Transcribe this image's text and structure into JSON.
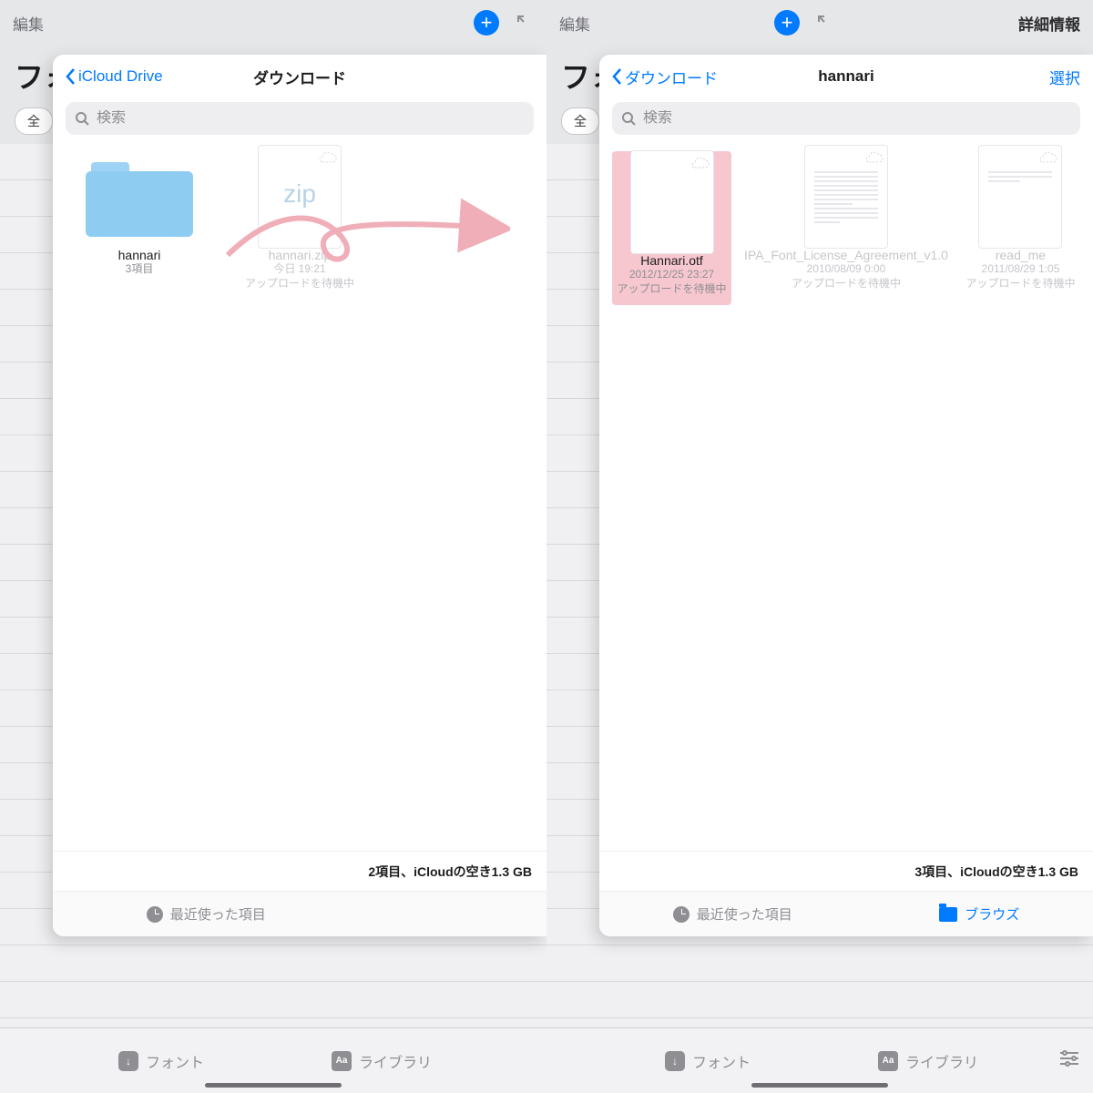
{
  "bg": {
    "edit": "編集",
    "heading_prefix": "フォ",
    "chip": "全",
    "details": "詳細情報",
    "bottom": {
      "fonts": "フォント",
      "library": "ライブラリ"
    }
  },
  "search": {
    "placeholder": "検索"
  },
  "left": {
    "back": "iCloud Drive",
    "title": "ダウンロード",
    "items": [
      {
        "type": "folder",
        "name": "hannari",
        "sub": "3項目"
      },
      {
        "type": "zip",
        "name": "hannari.zip",
        "sub1": "今日 19:21",
        "sub2": "アップロードを待機中"
      }
    ],
    "status": "2項目、iCloudの空き1.3 GB"
  },
  "right": {
    "back": "ダウンロード",
    "title": "hannari",
    "select": "選択",
    "items": [
      {
        "type": "file",
        "name": "Hannari.otf",
        "sub1": "2012/12/25 23:27",
        "sub2": "アップロードを待機中",
        "highlight": true
      },
      {
        "type": "file",
        "name": "IPA_Font_License_Agreement_v1.0",
        "sub1": "2010/08/09 0:00",
        "sub2": "アップロードを待機中",
        "faded": true,
        "lines": true
      },
      {
        "type": "file",
        "name": "read_me",
        "sub1": "2011/08/29 1:05",
        "sub2": "アップロードを待機中",
        "faded": true,
        "lines": true
      }
    ],
    "status": "3項目、iCloudの空き1.3 GB"
  },
  "tabs": {
    "recent": "最近使った項目",
    "browse": "ブラウズ"
  },
  "annotation": {
    "zip_label": "zip"
  }
}
